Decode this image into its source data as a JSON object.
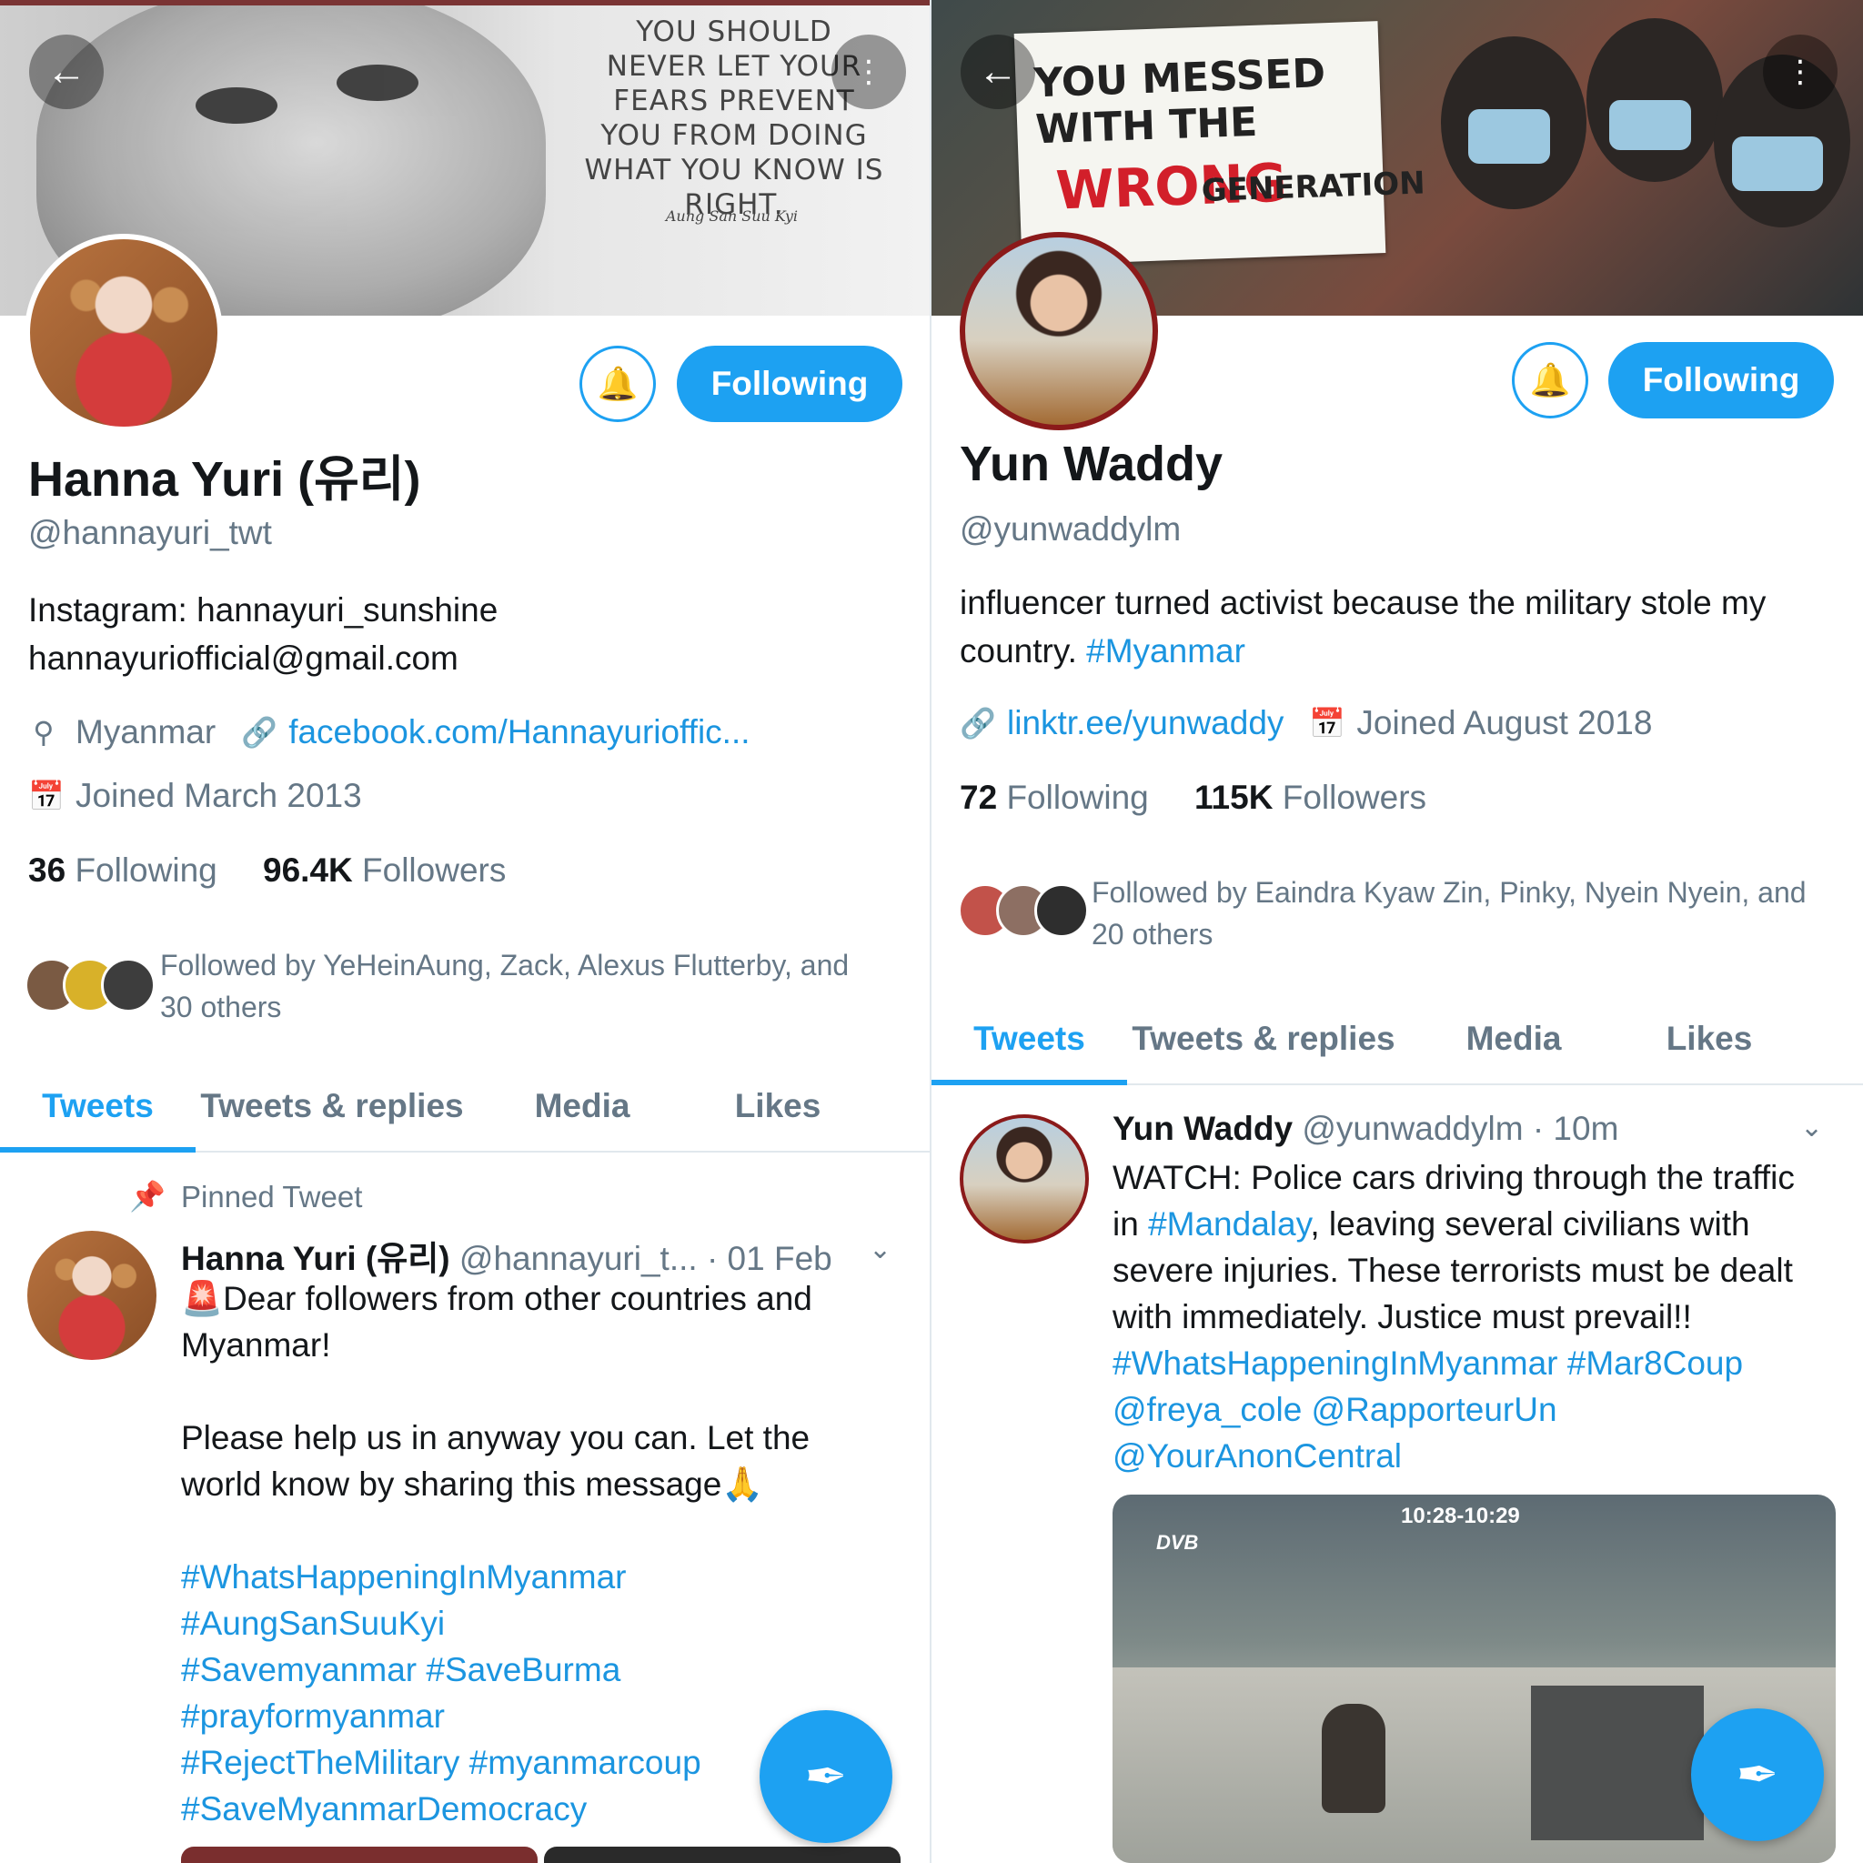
{
  "left": {
    "banner": {
      "quote": "YOU SHOULD NEVER LET YOUR FEARS PREVENT YOU FROM DOING WHAT YOU KNOW IS RIGHT.",
      "signature": "Aung San Suu Kyi"
    },
    "follow_label": "Following",
    "name": "Hanna Yuri (유리)",
    "handle": "@hannayuri_twt",
    "bio_line1": "Instagram: hannayuri_sunshine",
    "bio_line2": "hannayuriofficial@gmail.com",
    "location": "Myanmar",
    "website": "facebook.com/Hannayurioffic...",
    "joined": "Joined March 2013",
    "following_count": "36",
    "following_label": "Following",
    "followers_count": "96.4K",
    "followers_label": "Followers",
    "followed_by_line1": "Followed by YeHeinAung, Zack, Alexus Flutterby, and",
    "followed_by_line2": "30 others",
    "tabs": [
      "Tweets",
      "Tweets & replies",
      "Media",
      "Likes"
    ],
    "pinned_label": "Pinned Tweet",
    "tweet": {
      "name": "Hanna Yuri (유리)",
      "handle": "@hannayuri_t...",
      "time": "· 01 Feb",
      "line1": "🚨Dear followers from other countries and",
      "line2": "Myanmar!",
      "line3": "Please help us in anyway you can. Let the",
      "line4": "world know by sharing this message🙏",
      "tags1": "#WhatsHappeningInMyanmar",
      "tags2": "#AungSanSuuKyi",
      "tags3": "#Savemyanmar #SaveBurma",
      "tags4": "#prayformyanmar",
      "tags5": "#RejectTheMilitary #myanmarcoup",
      "tags6": "#SaveMyanmarDemocracy"
    }
  },
  "right": {
    "banner": {
      "sign_line1": "YOU MESSED WITH THE",
      "sign_line2": "WRONG",
      "sign_line3": "GENERATION"
    },
    "follow_label": "Following",
    "name": "Yun Waddy",
    "handle": "@yunwaddylm",
    "bio_line1": "influencer turned activist because the military stole my",
    "bio_line2_text": "country. ",
    "bio_line2_tag": "#Myanmar",
    "website": "linktr.ee/yunwaddy",
    "joined": "Joined August 2018",
    "following_count": "72",
    "following_label": "Following",
    "followers_count": "115K",
    "followers_label": "Followers",
    "followed_by_line1": "Followed by Eaindra Kyaw Zin, Pinky, Nyein Nyein, and",
    "followed_by_line2": "20 others",
    "tabs": [
      "Tweets",
      "Tweets & replies",
      "Media",
      "Likes"
    ],
    "tweet": {
      "name": "Yun Waddy",
      "handle": "@yunwaddylm",
      "time": "· 10m",
      "line1": "WATCH: Police cars driving through the traffic",
      "line2_pre": "in ",
      "line2_tag": "#Mandalay",
      "line2_post": ", leaving several civilians with",
      "line3": "severe injuries. These terrorists must be dealt",
      "line4": "with immediately. Justice must prevail!!",
      "tags1": "#WhatsHappeningInMyanmar #Mar8Coup",
      "tags2": "@freya_cole @RapporteurUn",
      "tags3": "@YourAnonCentral",
      "video_time": "10:28-10:29",
      "video_logo": "DVB"
    }
  },
  "colors": {
    "accent": "#1da1f2",
    "link": "#1b95e0",
    "muted": "#657786",
    "text": "#14171a"
  },
  "icons": [
    "back-arrow-icon",
    "more-vertical-icon",
    "bell-plus-icon",
    "location-pin-icon",
    "link-icon",
    "calendar-icon",
    "pin-icon",
    "chevron-down-icon",
    "compose-tweet-icon"
  ]
}
